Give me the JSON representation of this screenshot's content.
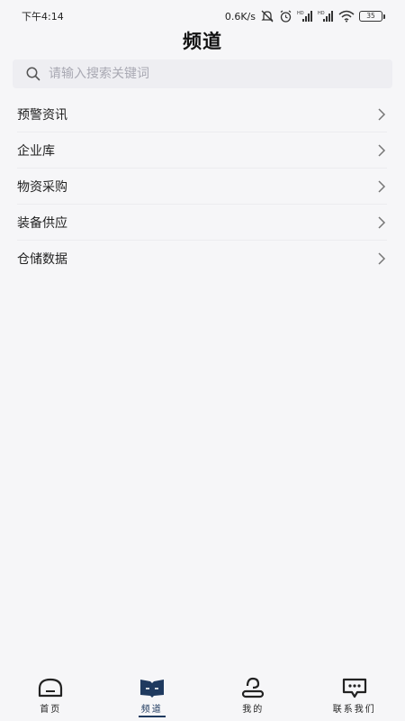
{
  "status_bar": {
    "time": "下午4:14",
    "network_speed": "0.6K/s",
    "battery": "35"
  },
  "header": {
    "title": "频道"
  },
  "search": {
    "placeholder": "请输入搜索关键词",
    "value": ""
  },
  "channels": [
    {
      "label": "预警资讯",
      "icon": "chevron-right-icon"
    },
    {
      "label": "企业库",
      "icon": "chevron-right-icon"
    },
    {
      "label": "物资采购",
      "icon": "chevron-right-icon"
    },
    {
      "label": "装备供应",
      "icon": "chevron-right-icon"
    },
    {
      "label": "仓储数据",
      "icon": "chevron-right-icon"
    }
  ],
  "bottom_nav": [
    {
      "label": "首页",
      "icon": "home-icon",
      "active": false
    },
    {
      "label": "频道",
      "icon": "book-icon",
      "active": true
    },
    {
      "label": "我的",
      "icon": "profile-icon",
      "active": false
    },
    {
      "label": "联系我们",
      "icon": "chat-icon",
      "active": false
    }
  ],
  "colors": {
    "accent": "#1f3a5f",
    "background": "#f6f6f8",
    "search_bg": "#eeeef2"
  }
}
